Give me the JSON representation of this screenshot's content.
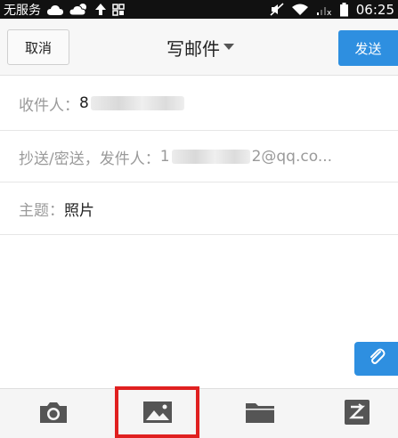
{
  "status_bar": {
    "carrier": "无服务",
    "time": "06:25",
    "icons": [
      "cloud-icon",
      "cloud-sun-icon",
      "upload-arrow-icon",
      "grid-icon",
      "mute-icon",
      "wifi-icon",
      "signal-off-icon",
      "battery-icon"
    ]
  },
  "header": {
    "cancel_label": "取消",
    "title": "写邮件",
    "send_label": "发送"
  },
  "fields": {
    "to_label": "收件人：",
    "to_value_visible": "8",
    "cc_label": "抄送/密送，发件人：",
    "cc_value_prefix": "1",
    "cc_value_visible": "2@qq.co...",
    "subject_label": "主题：",
    "subject_value": "照片"
  },
  "toolbar": {
    "items": [
      "camera-icon",
      "image-icon",
      "folder-icon",
      "scan-icon"
    ],
    "highlighted": "image-icon"
  },
  "colors": {
    "accent": "#2e8fe0",
    "highlight": "#e02020"
  }
}
